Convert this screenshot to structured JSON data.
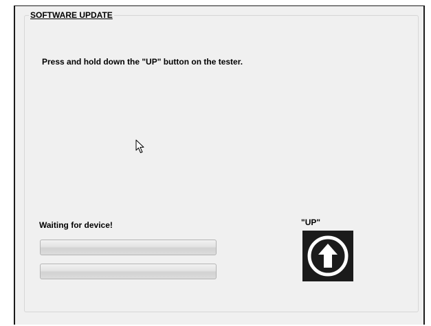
{
  "group": {
    "title": "SOFTWARE UPDATE"
  },
  "instruction": "Press and hold down the \"UP\" button on the tester.",
  "status": "Waiting for device!",
  "progress_bars": [
    {
      "value": 0
    },
    {
      "value": 0
    }
  ],
  "up_button": {
    "label": "\"UP\"",
    "icon": "up-arrow-circle-icon"
  },
  "colors": {
    "panel_background": "#f0f0f0",
    "icon_background": "#1b1b1b",
    "icon_foreground": "#ffffff"
  }
}
